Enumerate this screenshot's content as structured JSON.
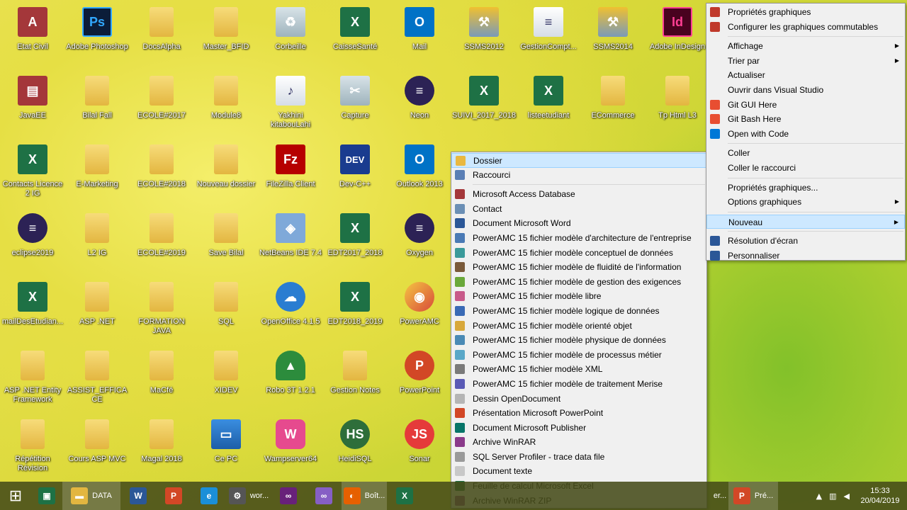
{
  "desktop_icons": [
    {
      "label": "Etat Civil",
      "icon": "access-file-icon",
      "glyph": "A",
      "cls": "g-access"
    },
    {
      "label": "Adobe Photoshop",
      "icon": "photoshop-icon",
      "glyph": "Ps",
      "cls": "g-ps"
    },
    {
      "label": "DocsAlpha",
      "icon": "folder-icon",
      "glyph": "",
      "cls": "g-folder"
    },
    {
      "label": "Master_BFID",
      "icon": "folder-icon",
      "glyph": "",
      "cls": "g-folder"
    },
    {
      "label": "Corbeille",
      "icon": "recycle-bin-icon",
      "glyph": "♻",
      "cls": "g-bin"
    },
    {
      "label": "CaisseSanté",
      "icon": "excel-file-icon",
      "glyph": "X",
      "cls": "g-excel"
    },
    {
      "label": "Mail",
      "icon": "outlook-icon",
      "glyph": "O",
      "cls": "g-outlook"
    },
    {
      "label": "SSMS2012",
      "icon": "tools-icon",
      "glyph": "⚒",
      "cls": "g-tools"
    },
    {
      "label": "GestionCompt...",
      "icon": "document-icon",
      "glyph": "≡",
      "cls": "g-generic"
    },
    {
      "label": "SSMS2014",
      "icon": "tools-icon",
      "glyph": "⚒",
      "cls": "g-tools"
    },
    {
      "label": "Adobe InDesign",
      "icon": "indesign-icon",
      "glyph": "Id",
      "cls": "g-id"
    },
    {
      "label": "JavaEE",
      "icon": "archive-icon",
      "glyph": "▤",
      "cls": "g-access"
    },
    {
      "label": "Bilal Fall",
      "icon": "user-folder-icon",
      "glyph": "",
      "cls": "g-folder"
    },
    {
      "label": "ECOLE#2017",
      "icon": "folder-icon",
      "glyph": "",
      "cls": "g-folder"
    },
    {
      "label": "Module8",
      "icon": "folder-icon",
      "glyph": "",
      "cls": "g-folder"
    },
    {
      "label": "Yakhini kitabouLahi",
      "icon": "mp3-file-icon",
      "glyph": "♪",
      "cls": "g-generic"
    },
    {
      "label": "Capture",
      "icon": "scissors-icon",
      "glyph": "✂",
      "cls": "g-bin"
    },
    {
      "label": "Neon",
      "icon": "eclipse-icon",
      "glyph": "≡",
      "cls": "g-eclipse"
    },
    {
      "label": "SUIVI_2017_2018",
      "icon": "excel-file-icon",
      "glyph": "X",
      "cls": "g-excel"
    },
    {
      "label": "listeetudiant",
      "icon": "excel-file-icon",
      "glyph": "X",
      "cls": "g-excel"
    },
    {
      "label": "ECommerce",
      "icon": "folder-icon",
      "glyph": "",
      "cls": "g-folder"
    },
    {
      "label": "Tp Html L3",
      "icon": "folder-icon",
      "glyph": "",
      "cls": "g-folder"
    },
    {
      "label": "Contacts Licence 2 IG",
      "icon": "excel-file-icon",
      "glyph": "X",
      "cls": "g-excel"
    },
    {
      "label": "E-Marketing",
      "icon": "folder-icon",
      "glyph": "",
      "cls": "g-folder"
    },
    {
      "label": "ECOLE#2018",
      "icon": "folder-icon",
      "glyph": "",
      "cls": "g-folder"
    },
    {
      "label": "Nouveau dossier",
      "icon": "folder-icon",
      "glyph": "",
      "cls": "g-folder"
    },
    {
      "label": "FileZilla Client",
      "icon": "filezilla-icon",
      "glyph": "Fz",
      "cls": "g-fz"
    },
    {
      "label": "Dev-C++",
      "icon": "devcpp-icon",
      "glyph": "DEV",
      "cls": "g-dev"
    },
    {
      "label": "Outlook 2013",
      "icon": "outlook-icon",
      "glyph": "O",
      "cls": "g-outlook"
    },
    {
      "label": "eclipse2019",
      "icon": "eclipse-icon",
      "glyph": "≡",
      "cls": "g-eclipse"
    },
    {
      "label": "L2 IG",
      "icon": "folder-icon",
      "glyph": "",
      "cls": "g-folder"
    },
    {
      "label": "ECOLE#2019",
      "icon": "folder-icon",
      "glyph": "",
      "cls": "g-folder"
    },
    {
      "label": "Save Bilal",
      "icon": "folder-icon",
      "glyph": "",
      "cls": "g-folder"
    },
    {
      "label": "NetBeans IDE 7.4",
      "icon": "netbeans-icon",
      "glyph": "◈",
      "cls": "g-nb"
    },
    {
      "label": "EDT2017_2018",
      "icon": "excel-file-icon",
      "glyph": "X",
      "cls": "g-excel"
    },
    {
      "label": "Oxygen",
      "icon": "eclipse-icon",
      "glyph": "≡",
      "cls": "g-eclipse"
    },
    {
      "label": "mailDesEtudian...",
      "icon": "excel-file-icon",
      "glyph": "X",
      "cls": "g-excel"
    },
    {
      "label": "ASP .NET",
      "icon": "folder-icon",
      "glyph": "",
      "cls": "g-folder"
    },
    {
      "label": "FORMATION JAVA",
      "icon": "folder-icon",
      "glyph": "",
      "cls": "g-folder"
    },
    {
      "label": "SQL",
      "icon": "folder-icon",
      "glyph": "",
      "cls": "g-folder"
    },
    {
      "label": "OpenOffice 4.1.5",
      "icon": "openoffice-icon",
      "glyph": "☁",
      "cls": "g-oo"
    },
    {
      "label": "EDT2018_2019",
      "icon": "excel-file-icon",
      "glyph": "X",
      "cls": "g-excel"
    },
    {
      "label": "PowerAMC",
      "icon": "poweramc-icon",
      "glyph": "◉",
      "cls": "g-amc"
    },
    {
      "label": "ASP .NET Entity Framework",
      "icon": "folder-icon",
      "glyph": "",
      "cls": "g-folder"
    },
    {
      "label": "ASSIST_EFFICACE",
      "icon": "folder-icon",
      "glyph": "",
      "cls": "g-folder"
    },
    {
      "label": "MaCfé",
      "icon": "folder-icon",
      "glyph": "",
      "cls": "g-folder"
    },
    {
      "label": "XIDEV",
      "icon": "folder-icon",
      "glyph": "",
      "cls": "g-folder"
    },
    {
      "label": "Robo 3T 1.2.1",
      "icon": "robo3t-icon",
      "glyph": "▲",
      "cls": "g-robo"
    },
    {
      "label": "Gestion Notes",
      "icon": "folder-icon",
      "glyph": "",
      "cls": "g-folder"
    },
    {
      "label": "PowerPoint",
      "icon": "powerpoint-icon",
      "glyph": "P",
      "cls": "g-ppt"
    },
    {
      "label": "Répétition Révision",
      "icon": "folder-icon",
      "glyph": "",
      "cls": "g-folder"
    },
    {
      "label": "Cours ASP MVC",
      "icon": "folder-icon",
      "glyph": "",
      "cls": "g-folder"
    },
    {
      "label": "Magal 2018",
      "icon": "folder-icon",
      "glyph": "",
      "cls": "g-folder"
    },
    {
      "label": "Ce PC",
      "icon": "computer-icon",
      "glyph": "▭",
      "cls": "g-pc"
    },
    {
      "label": "Wampserver64",
      "icon": "wampserver-icon",
      "glyph": "W",
      "cls": "g-wamp"
    },
    {
      "label": "HeidiSQL",
      "icon": "heidisql-icon",
      "glyph": "HS",
      "cls": "g-hs"
    },
    {
      "label": "Sonar",
      "icon": "sonar-icon",
      "glyph": "JS",
      "cls": "g-sonar"
    }
  ],
  "new_submenu": {
    "items": [
      {
        "label": "Dossier",
        "icon": "folder-icon",
        "color": "#e9b840",
        "highlighted": true
      },
      {
        "label": "Raccourci",
        "icon": "shortcut-icon",
        "color": "#5a7fb5"
      },
      {
        "sep": true
      },
      {
        "label": "Microsoft Access Database",
        "icon": "access-icon",
        "color": "#a4373a"
      },
      {
        "label": "Contact",
        "icon": "contact-icon",
        "color": "#6b8fb5"
      },
      {
        "label": "Document Microsoft Word",
        "icon": "word-icon",
        "color": "#2b5797"
      },
      {
        "label": "PowerAMC 15 fichier modèle d'architecture de l'entreprise",
        "icon": "poweramc-model-icon",
        "color": "#4a7ab5"
      },
      {
        "label": "PowerAMC 15 fichier modèle conceptuel de données",
        "icon": "poweramc-model-icon",
        "color": "#3a9a9a"
      },
      {
        "label": "PowerAMC 15 fichier modèle de fluidité de l'information",
        "icon": "poweramc-model-icon",
        "color": "#7a5a3a"
      },
      {
        "label": "PowerAMC 15 fichier modèle de gestion des exigences",
        "icon": "poweramc-model-icon",
        "color": "#6aa83a"
      },
      {
        "label": "PowerAMC 15 fichier modèle libre",
        "icon": "poweramc-model-icon",
        "color": "#c85a8a"
      },
      {
        "label": "PowerAMC 15 fichier modèle logique de données",
        "icon": "poweramc-model-icon",
        "color": "#3a6ab5"
      },
      {
        "label": "PowerAMC 15 fichier modèle orienté objet",
        "icon": "poweramc-model-icon",
        "color": "#d8a83a"
      },
      {
        "label": "PowerAMC 15 fichier modèle physique de données",
        "icon": "poweramc-model-icon",
        "color": "#4a8ab5"
      },
      {
        "label": "PowerAMC 15 fichier modèle de processus métier",
        "icon": "poweramc-model-icon",
        "color": "#5aa8c8"
      },
      {
        "label": "PowerAMC 15 fichier modèle XML",
        "icon": "poweramc-model-icon",
        "color": "#7a7a7a"
      },
      {
        "label": "PowerAMC 15 fichier modèle de traitement Merise",
        "icon": "poweramc-model-icon",
        "color": "#5a5ab5"
      },
      {
        "label": "Dessin OpenDocument",
        "icon": "odg-icon",
        "color": "#b5b5b5"
      },
      {
        "label": "Présentation Microsoft PowerPoint",
        "icon": "powerpoint-icon",
        "color": "#d24726"
      },
      {
        "label": "Document Microsoft Publisher",
        "icon": "publisher-icon",
        "color": "#077568"
      },
      {
        "label": "Archive WinRAR",
        "icon": "winrar-icon",
        "color": "#8a3a8a"
      },
      {
        "label": "SQL Server Profiler - trace data file",
        "icon": "sql-profiler-icon",
        "color": "#9a9a9a"
      },
      {
        "label": "Document texte",
        "icon": "text-file-icon",
        "color": "#c8c8c8"
      },
      {
        "label": "Feuille de calcul Microsoft Excel",
        "icon": "excel-icon",
        "color": "#1e7145"
      },
      {
        "label": "Archive WinRAR ZIP",
        "icon": "winrar-zip-icon",
        "color": "#8a3a8a"
      }
    ]
  },
  "desktop_menu": {
    "items": [
      {
        "label": "Propriétés graphiques",
        "icon": "graphics-icon",
        "color": "#c0392b"
      },
      {
        "label": "Configurer les graphiques commutables",
        "icon": "graphics-switch-icon",
        "color": "#c0392b"
      },
      {
        "sep": true
      },
      {
        "label": "Affichage",
        "submenu": true
      },
      {
        "label": "Trier par",
        "submenu": true
      },
      {
        "label": "Actualiser"
      },
      {
        "label": "Ouvrir dans Visual Studio"
      },
      {
        "label": "Git GUI Here",
        "icon": "git-icon",
        "color": "#e84e31"
      },
      {
        "label": "Git Bash Here",
        "icon": "git-icon",
        "color": "#e84e31"
      },
      {
        "label": "Open with Code",
        "icon": "vscode-icon",
        "color": "#0078d7"
      },
      {
        "sep": true
      },
      {
        "label": "Coller"
      },
      {
        "label": "Coller le raccourci"
      },
      {
        "sep": true
      },
      {
        "label": "Propriétés graphiques..."
      },
      {
        "label": "Options graphiques",
        "submenu": true
      },
      {
        "sep": true
      },
      {
        "label": "Nouveau",
        "submenu": true,
        "highlighted": true
      },
      {
        "sep": true
      },
      {
        "label": "Résolution d'écran",
        "icon": "display-icon",
        "color": "#2b5797"
      },
      {
        "label": "Personnaliser",
        "icon": "personalize-icon",
        "color": "#2b5797"
      }
    ]
  },
  "taskbar": {
    "items": [
      {
        "label": "",
        "icon": "start-icon",
        "glyph": "⊞",
        "color": "transparent"
      },
      {
        "label": "",
        "icon": "store-icon",
        "glyph": "▣",
        "color": "#1e7145"
      },
      {
        "label": "DATA",
        "icon": "folder-icon",
        "glyph": "▬",
        "color": "#e3b640",
        "active": true
      },
      {
        "label": "",
        "icon": "word-icon",
        "glyph": "W",
        "color": "#2b5797"
      },
      {
        "label": "",
        "icon": "powerpoint-icon",
        "glyph": "P",
        "color": "#d24726"
      },
      {
        "label": "",
        "icon": "ie-icon",
        "glyph": "e",
        "color": "#1b8fd8"
      },
      {
        "label": "wor...",
        "icon": "devcpp-icon",
        "glyph": "⚙",
        "color": "#555"
      },
      {
        "label": "",
        "icon": "visual-studio-icon",
        "glyph": "∞",
        "color": "#68217a"
      },
      {
        "label": "",
        "icon": "visual-studio-icon",
        "glyph": "∞",
        "color": "#865fc5"
      },
      {
        "label": "Boît...",
        "icon": "firefox-icon",
        "glyph": "◐",
        "color": "#e66000",
        "active": true
      },
      {
        "label": "",
        "icon": "excel-icon",
        "glyph": "X",
        "color": "#1e7145"
      }
    ],
    "right_items": [
      {
        "label": "er...",
        "icon": "window-icon",
        "glyph": "",
        "color": "transparent"
      },
      {
        "label": "Pré...",
        "icon": "powerpoint-icon",
        "glyph": "P",
        "color": "#d24726",
        "active": true
      }
    ],
    "time": "15:33",
    "date": "20/04/2019"
  }
}
